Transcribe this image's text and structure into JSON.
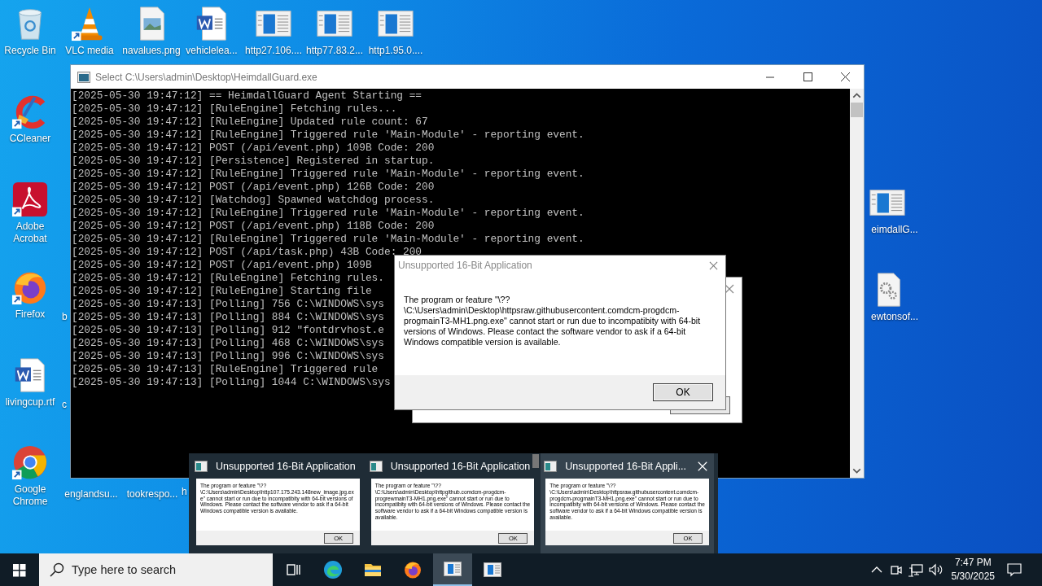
{
  "desktop_icons": [
    {
      "label": "Recycle Bin",
      "kind": "recycle",
      "shortcut": false
    },
    {
      "label": "VLC media",
      "kind": "vlc",
      "shortcut": true
    },
    {
      "label": "navalues.png",
      "kind": "image",
      "shortcut": false
    },
    {
      "label": "vehiclelea...",
      "kind": "word",
      "shortcut": false
    },
    {
      "label": "http27.106....",
      "kind": "app",
      "shortcut": false
    },
    {
      "label": "http77.83.2...",
      "kind": "app",
      "shortcut": false
    },
    {
      "label": "http1.95.0....",
      "kind": "app",
      "shortcut": false
    },
    {
      "label": "CCleaner",
      "kind": "ccleaner",
      "shortcut": true
    },
    {
      "label": "Adobe Acrobat",
      "kind": "acrobat",
      "shortcut": true
    },
    {
      "label": "Firefox",
      "kind": "firefox",
      "shortcut": true
    },
    {
      "label": "livingcup.rtf",
      "kind": "word",
      "shortcut": false
    },
    {
      "label": "Google Chrome",
      "kind": "chrome",
      "shortcut": true
    },
    {
      "label": "b",
      "kind": "label"
    },
    {
      "label": "c",
      "kind": "label"
    },
    {
      "label": "englandsu...",
      "kind": "label"
    },
    {
      "label": "tookrespo...",
      "kind": "label"
    },
    {
      "label": "h",
      "kind": "label"
    },
    {
      "label": "eimdallG...",
      "kind": "app",
      "shortcut": false
    },
    {
      "label": "ewtonsof...",
      "kind": "gears",
      "shortcut": false
    }
  ],
  "console": {
    "title": "Select C:\\Users\\admin\\Desktop\\HeimdallGuard.exe",
    "lines": [
      "[2025-05-30 19:47:12] == HeimdallGuard Agent Starting ==",
      "[2025-05-30 19:47:12] [RuleEngine] Fetching rules...",
      "[2025-05-30 19:47:12] [RuleEngine] Updated rule count: 67",
      "[2025-05-30 19:47:12] [RuleEngine] Triggered rule 'Main-Module' - reporting event.",
      "[2025-05-30 19:47:12] POST (/api/event.php) 109B Code: 200",
      "[2025-05-30 19:47:12] [Persistence] Registered in startup.",
      "[2025-05-30 19:47:12] [RuleEngine] Triggered rule 'Main-Module' - reporting event.",
      "[2025-05-30 19:47:12] POST (/api/event.php) 126B Code: 200",
      "[2025-05-30 19:47:12] [Watchdog] Spawned watchdog process.",
      "[2025-05-30 19:47:12] [RuleEngine] Triggered rule 'Main-Module' - reporting event.",
      "[2025-05-30 19:47:12] POST (/api/event.php) 118B Code: 200",
      "[2025-05-30 19:47:12] [RuleEngine] Triggered rule 'Main-Module' - reporting event.",
      "[2025-05-30 19:47:12] POST (/api/task.php) 43B Code: 200",
      "[2025-05-30 19:47:12] POST (/api/event.php) 109B",
      "[2025-05-30 19:47:12] [RuleEngine] Fetching rules.",
      "[2025-05-30 19:47:12] [RuleEngine] Starting file",
      "[2025-05-30 19:47:13] [Polling] 756 C:\\WINDOWS\\sys",
      "[2025-05-30 19:47:13] [Polling] 884 C:\\WINDOWS\\sys",
      "[2025-05-30 19:47:13] [Polling] 912 \"fontdrvhost.e",
      "[2025-05-30 19:47:13] [Polling] 468 C:\\WINDOWS\\sys",
      "[2025-05-30 19:47:13] [Polling] 996 C:\\WINDOWS\\sys",
      "[2025-05-30 19:47:13] [RuleEngine] Triggered rule",
      "[2025-05-30 19:47:13] [Polling] 1044 C:\\WINDOWS\\sys"
    ]
  },
  "dialog": {
    "title": "Unsupported 16-Bit Application",
    "message": "The program or feature \"\\??\\C:\\Users\\admin\\Desktop\\httpsraw.githubusercontent.comdcm-progdcm-progmainT3-MH1.png.exe\" cannot start or run due to incompatibity with 64-bit versions of Windows. Please contact the software vendor to ask if a 64-bit Windows compatible version is available.",
    "button": "OK"
  },
  "thumbnails": [
    {
      "title": "Unsupported 16-Bit Application",
      "message": "The program or feature \"\\??\\C:\\Users\\admin\\Desktop\\http107.175.243.148new_image.jpg.exe\" cannot start or run due to incompatibity with 64-bit versions of Windows. Please contact the software vendor to ask if a 64-bit Windows compatible version is available.",
      "button": "OK",
      "hovered": false
    },
    {
      "title": "Unsupported 16-Bit Application",
      "message": "The program or feature \"\\??\\C:\\Users\\admin\\Desktop\\httpgithub.comdcm-progdcm-progrewmainT3-MH1.png.exe\" cannot start or run due to incompatibity with 64-bit versions of Windows. Please contact the software vendor to ask if a 64-bit Windows compatible version is available.",
      "button": "OK",
      "hovered": false
    },
    {
      "title": "Unsupported 16-Bit Appli...",
      "message": "The program or feature \"\\??\\C:\\Users\\admin\\Desktop\\httpsraw.githubusercontent.comdcm-progdcm-progmainT3-MH1.png.exe\" cannot start or run due to incompatibity with 64-bit versions of Windows. Please contact the software vendor to ask if a 64-bit Windows compatible version is available.",
      "button": "OK",
      "hovered": true
    }
  ],
  "taskbar": {
    "search": {
      "placeholder": "Type here to search"
    },
    "apps": [
      {
        "kind": "taskview",
        "active": false
      },
      {
        "kind": "edge",
        "active": false
      },
      {
        "kind": "explorer",
        "active": false
      },
      {
        "kind": "firefox",
        "active": false
      },
      {
        "kind": "app",
        "active": true
      },
      {
        "kind": "app",
        "active": false
      }
    ],
    "clock": {
      "time": "7:47 PM",
      "date": "5/30/2025"
    }
  }
}
